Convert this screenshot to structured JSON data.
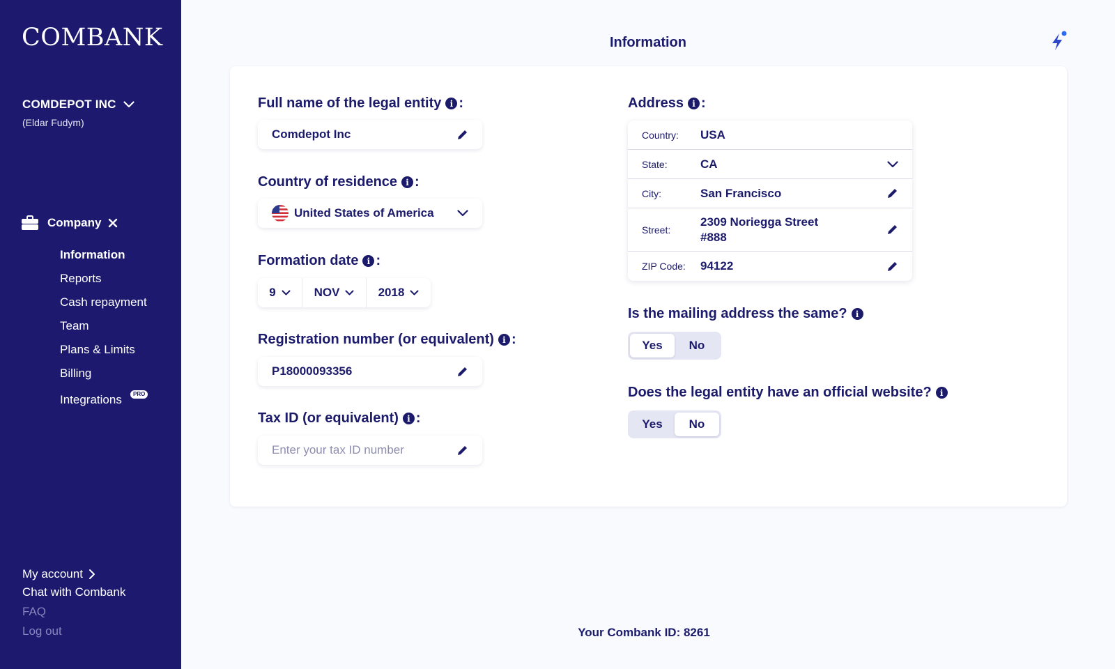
{
  "brand": {
    "logo": "COMBANK"
  },
  "account": {
    "company": "COMDEPOT INC",
    "user": "(Eldar Fudym)"
  },
  "nav": {
    "section": "Company",
    "items": [
      {
        "label": "Information",
        "active": true
      },
      {
        "label": "Reports"
      },
      {
        "label": "Cash repayment"
      },
      {
        "label": "Team"
      },
      {
        "label": "Plans & Limits"
      },
      {
        "label": "Billing"
      },
      {
        "label": "Integrations",
        "badge": "PRO"
      }
    ]
  },
  "bottom_links": {
    "my_account": "My account",
    "chat": "Chat with Combank",
    "faq": "FAQ",
    "logout": "Log out"
  },
  "page": {
    "title": "Information"
  },
  "form": {
    "legal_name": {
      "label": "Full name of the legal entity",
      "value": "Comdepot Inc"
    },
    "country": {
      "label": "Country of residence",
      "value": "United States of America"
    },
    "formation": {
      "label": "Formation date",
      "day": "9",
      "month": "NOV",
      "year": "2018"
    },
    "registration": {
      "label": "Registration number (or equivalent)",
      "value": "P18000093356"
    },
    "tax": {
      "label": "Tax ID (or equivalent)",
      "placeholder": "Enter your tax ID number"
    },
    "address": {
      "label": "Address",
      "rows": [
        {
          "key": "Country:",
          "value": "USA"
        },
        {
          "key": "State:",
          "value": "CA"
        },
        {
          "key": "City:",
          "value": "San Francisco"
        },
        {
          "key": "Street:",
          "value_line1": "2309 Noriegga Street",
          "value_line2": "#888"
        },
        {
          "key": "ZIP Code:",
          "value": "94122"
        }
      ]
    },
    "mailing": {
      "question": "Is the mailing address the same?",
      "yes": "Yes",
      "no": "No",
      "selected": "Yes"
    },
    "website": {
      "question": "Does the legal entity have an official website?",
      "yes": "Yes",
      "no": "No",
      "selected": "No"
    }
  },
  "footer": {
    "combank_id": "Your Combank ID: 8261"
  },
  "colors": {
    "sidebar": "#1C196E",
    "text": "#1B1A6B",
    "accent": "#2F5BE7",
    "background": "#F9FAFE"
  },
  "icons": [
    "chevron-down-icon",
    "briefcase-icon",
    "close-icon",
    "info-icon",
    "edit-pencil-icon",
    "us-flag-icon",
    "lightning-icon",
    "chevron-right-icon"
  ]
}
